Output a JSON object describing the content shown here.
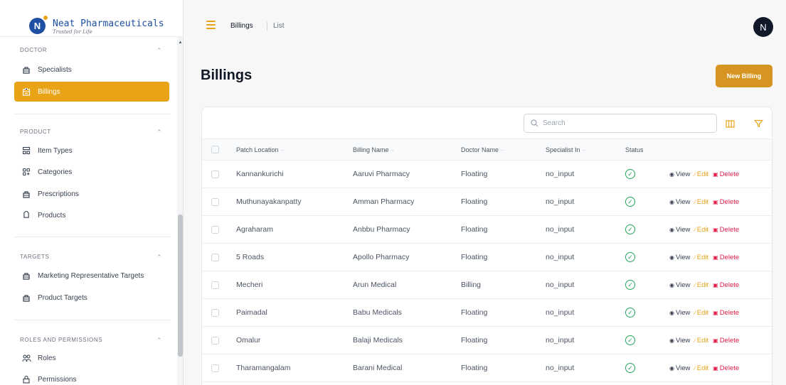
{
  "brand": {
    "name": "Neat Pharmaceuticals",
    "tagline": "Trusted for Life",
    "logo_letter": "N"
  },
  "sidebar": {
    "sections": [
      {
        "title": "DOCTOR",
        "items": [
          {
            "label": "Specialists",
            "icon": "bag-icon",
            "active": false
          },
          {
            "label": "Billings",
            "icon": "billing-icon",
            "active": true
          }
        ]
      },
      {
        "title": "PRODUCT",
        "items": [
          {
            "label": "Item Types",
            "icon": "item-types-icon"
          },
          {
            "label": "Categories",
            "icon": "categories-icon"
          },
          {
            "label": "Prescriptions",
            "icon": "bag-icon"
          },
          {
            "label": "Products",
            "icon": "tag-icon"
          }
        ]
      },
      {
        "title": "TARGETS",
        "items": [
          {
            "label": "Marketing Representative Targets",
            "icon": "bag-icon"
          },
          {
            "label": "Product Targets",
            "icon": "bag-icon"
          }
        ]
      },
      {
        "title": "ROLES AND PERMISSIONS",
        "items": [
          {
            "label": "Roles",
            "icon": "users-icon"
          },
          {
            "label": "Permissions",
            "icon": "lock-icon"
          }
        ]
      }
    ]
  },
  "topbar": {
    "breadcrumb": [
      "Billings",
      "List"
    ],
    "avatar_initial": "N"
  },
  "page": {
    "title": "Billings",
    "new_button": "New Billing"
  },
  "table": {
    "search_placeholder": "Search",
    "columns": [
      "Patch Location",
      "Billing Name",
      "Doctor Name",
      "Specialist In",
      "Status"
    ],
    "actions": {
      "view": "View",
      "edit": "Edit",
      "delete": "Delete"
    },
    "rows": [
      {
        "patch_location": "Kannankurichi",
        "billing_name": "Aaruvi Pharmacy",
        "doctor_name": "Floating",
        "specialist_in": "no_input"
      },
      {
        "patch_location": "Muthunayakanpatty",
        "billing_name": "Amman Pharmacy",
        "doctor_name": "Floating",
        "specialist_in": "no_input"
      },
      {
        "patch_location": "Agraharam",
        "billing_name": "Anbbu Pharmacy",
        "doctor_name": "Floating",
        "specialist_in": "no_input"
      },
      {
        "patch_location": "5 Roads",
        "billing_name": "Apollo Pharmacy",
        "doctor_name": "Floating",
        "specialist_in": "no_input"
      },
      {
        "patch_location": "Mecheri",
        "billing_name": "Arun Medical",
        "doctor_name": "Billing",
        "specialist_in": "no_input"
      },
      {
        "patch_location": "Paimadal",
        "billing_name": "Babu Medicals",
        "doctor_name": "Floating",
        "specialist_in": "no_input"
      },
      {
        "patch_location": "Omalur",
        "billing_name": "Balaji Medicals",
        "doctor_name": "Floating",
        "specialist_in": "no_input"
      },
      {
        "patch_location": "Tharamangalam",
        "billing_name": "Barani Medical",
        "doctor_name": "Floating",
        "specialist_in": "no_input"
      }
    ]
  },
  "colors": {
    "accent": "#e8a317",
    "button": "#d69520",
    "status_green": "#22a75b",
    "delete_red": "#e11d48",
    "brand_blue": "#1e4fa3"
  }
}
